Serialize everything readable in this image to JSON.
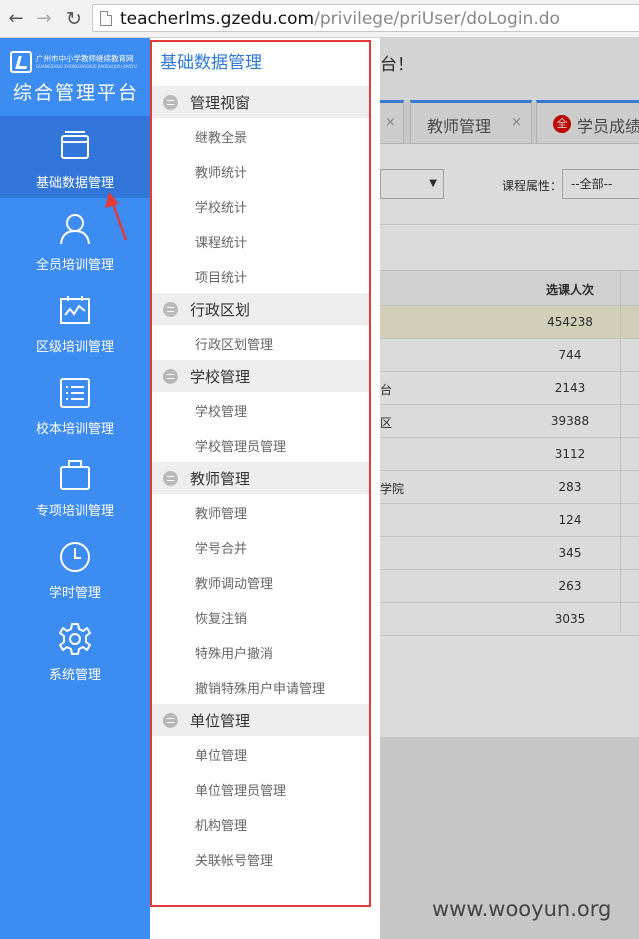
{
  "browser": {
    "url_host": "teacherlms.gzedu.com",
    "url_path": "/privilege/priUser/doLogin.do"
  },
  "sidebar": {
    "logo_cn": "广州市中小学教师继续教育网",
    "logo_en": "GUANGZHOU ZHONGXIAOXUE JIAOSHI JIXU JIAOYU",
    "title": "综合管理平台",
    "items": [
      {
        "label": "基础数据管理",
        "icon": "monitor-icon",
        "active": true
      },
      {
        "label": "全员培训管理",
        "icon": "user-icon",
        "active": false
      },
      {
        "label": "区级培训管理",
        "icon": "chart-board-icon",
        "active": false
      },
      {
        "label": "校本培训管理",
        "icon": "list-icon",
        "active": false
      },
      {
        "label": "专项培训管理",
        "icon": "briefcase-icon",
        "active": false
      },
      {
        "label": "学时管理",
        "icon": "clock-icon",
        "active": false
      },
      {
        "label": "系统管理",
        "icon": "gear-icon",
        "active": false
      }
    ]
  },
  "topbar": {
    "welcome_tail": "台！"
  },
  "tabs": [
    {
      "label": "",
      "closable": true
    },
    {
      "label": "教师管理",
      "closable": true
    },
    {
      "label": "学员成绩",
      "badge": "全",
      "closable": false
    }
  ],
  "filters": {
    "course_attr_label": "课程属性：",
    "course_attr_value": "--全部--"
  },
  "table": {
    "header": "选课人次",
    "rows": [
      {
        "name": "",
        "value": "454238",
        "highlight": true
      },
      {
        "name": "",
        "value": "744"
      },
      {
        "name": "台",
        "value": "2143"
      },
      {
        "name": "区",
        "value": "39388"
      },
      {
        "name": "",
        "value": "3112"
      },
      {
        "name": "学院",
        "value": "283"
      },
      {
        "name": "",
        "value": "124"
      },
      {
        "name": "",
        "value": "345"
      },
      {
        "name": "",
        "value": "263"
      },
      {
        "name": "",
        "value": "3035"
      }
    ]
  },
  "submenu": {
    "title": "基础数据管理",
    "groups": [
      {
        "label": "管理视窗",
        "items": [
          "继教全景",
          "教师统计",
          "学校统计",
          "课程统计",
          "项目统计"
        ]
      },
      {
        "label": "行政区划",
        "items": [
          "行政区划管理"
        ]
      },
      {
        "label": "学校管理",
        "items": [
          "学校管理",
          "学校管理员管理"
        ]
      },
      {
        "label": "教师管理",
        "items": [
          "教师管理",
          "学号合并",
          "教师调动管理",
          "恢复注销",
          "特殊用户撤消",
          "撤销特殊用户申请管理"
        ]
      },
      {
        "label": "单位管理",
        "items": [
          "单位管理",
          "单位管理员管理",
          "机构管理",
          "关联帐号管理"
        ]
      }
    ]
  },
  "watermark": "www.wooyun.org"
}
